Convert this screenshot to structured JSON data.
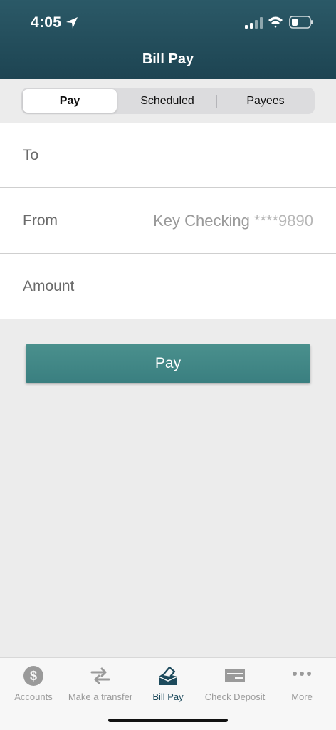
{
  "status_bar": {
    "time": "4:05"
  },
  "header": {
    "title": "Bill Pay"
  },
  "segments": [
    {
      "label": "Pay",
      "active": true
    },
    {
      "label": "Scheduled",
      "active": false
    },
    {
      "label": "Payees",
      "active": false
    }
  ],
  "form": {
    "to_label": "To",
    "from_label": "From",
    "from_account_name": "Key Checking",
    "from_account_number": "****9890",
    "amount_label": "Amount"
  },
  "pay_button_label": "Pay",
  "tabbar": {
    "items": [
      {
        "label": "Accounts",
        "icon": "dollar-coin-icon",
        "active": false
      },
      {
        "label": "Make a transfer",
        "icon": "transfer-arrows-icon",
        "active": false
      },
      {
        "label": "Bill Pay",
        "icon": "bill-pay-icon",
        "active": true
      },
      {
        "label": "Check Deposit",
        "icon": "check-icon",
        "active": false
      },
      {
        "label": "More",
        "icon": "more-dots-icon",
        "active": false
      }
    ]
  },
  "colors": {
    "header": "#245160",
    "accent": "#3f8686",
    "active_tab": "#1d4a5c",
    "inactive_tab": "#9a9a9a"
  }
}
